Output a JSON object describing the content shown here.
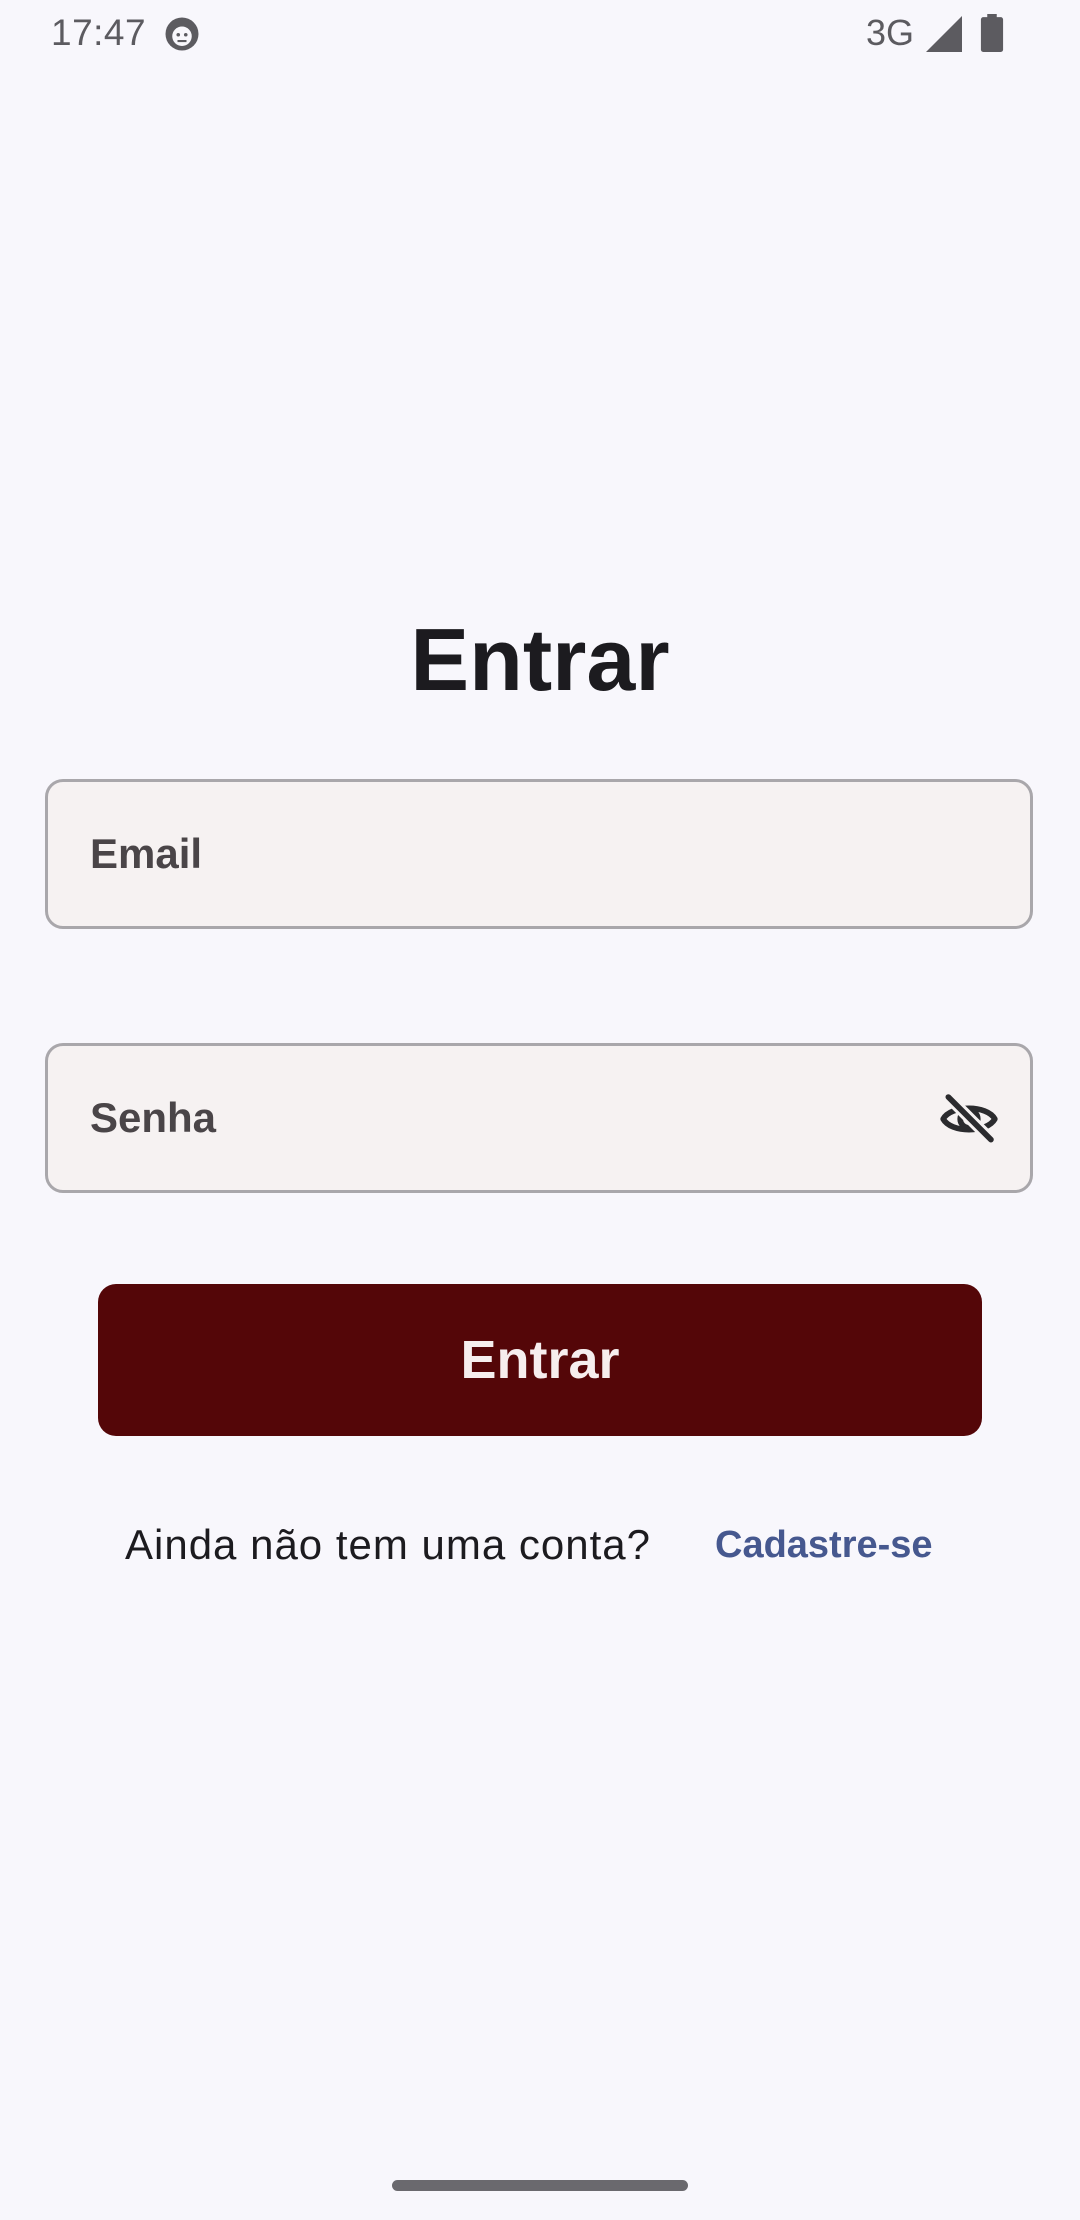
{
  "status_bar": {
    "time": "17:47",
    "network": "3G",
    "icons": [
      "face-icon",
      "signal-icon",
      "battery-icon"
    ]
  },
  "login": {
    "title": "Entrar",
    "email_label": "Email",
    "password_label": "Senha",
    "password_toggle_icon": "eye-off-icon",
    "submit_label": "Entrar",
    "signup_prompt": "Ainda não tem uma conta?",
    "signup_link": "Cadastre-se"
  },
  "colors": {
    "background": "#f8f7fc",
    "field_background": "#f6f2f2",
    "field_border": "#a9a7ab",
    "button_background": "#540608",
    "button_text": "#f6eeee",
    "link": "#46588f",
    "title": "#1c1b1f"
  }
}
